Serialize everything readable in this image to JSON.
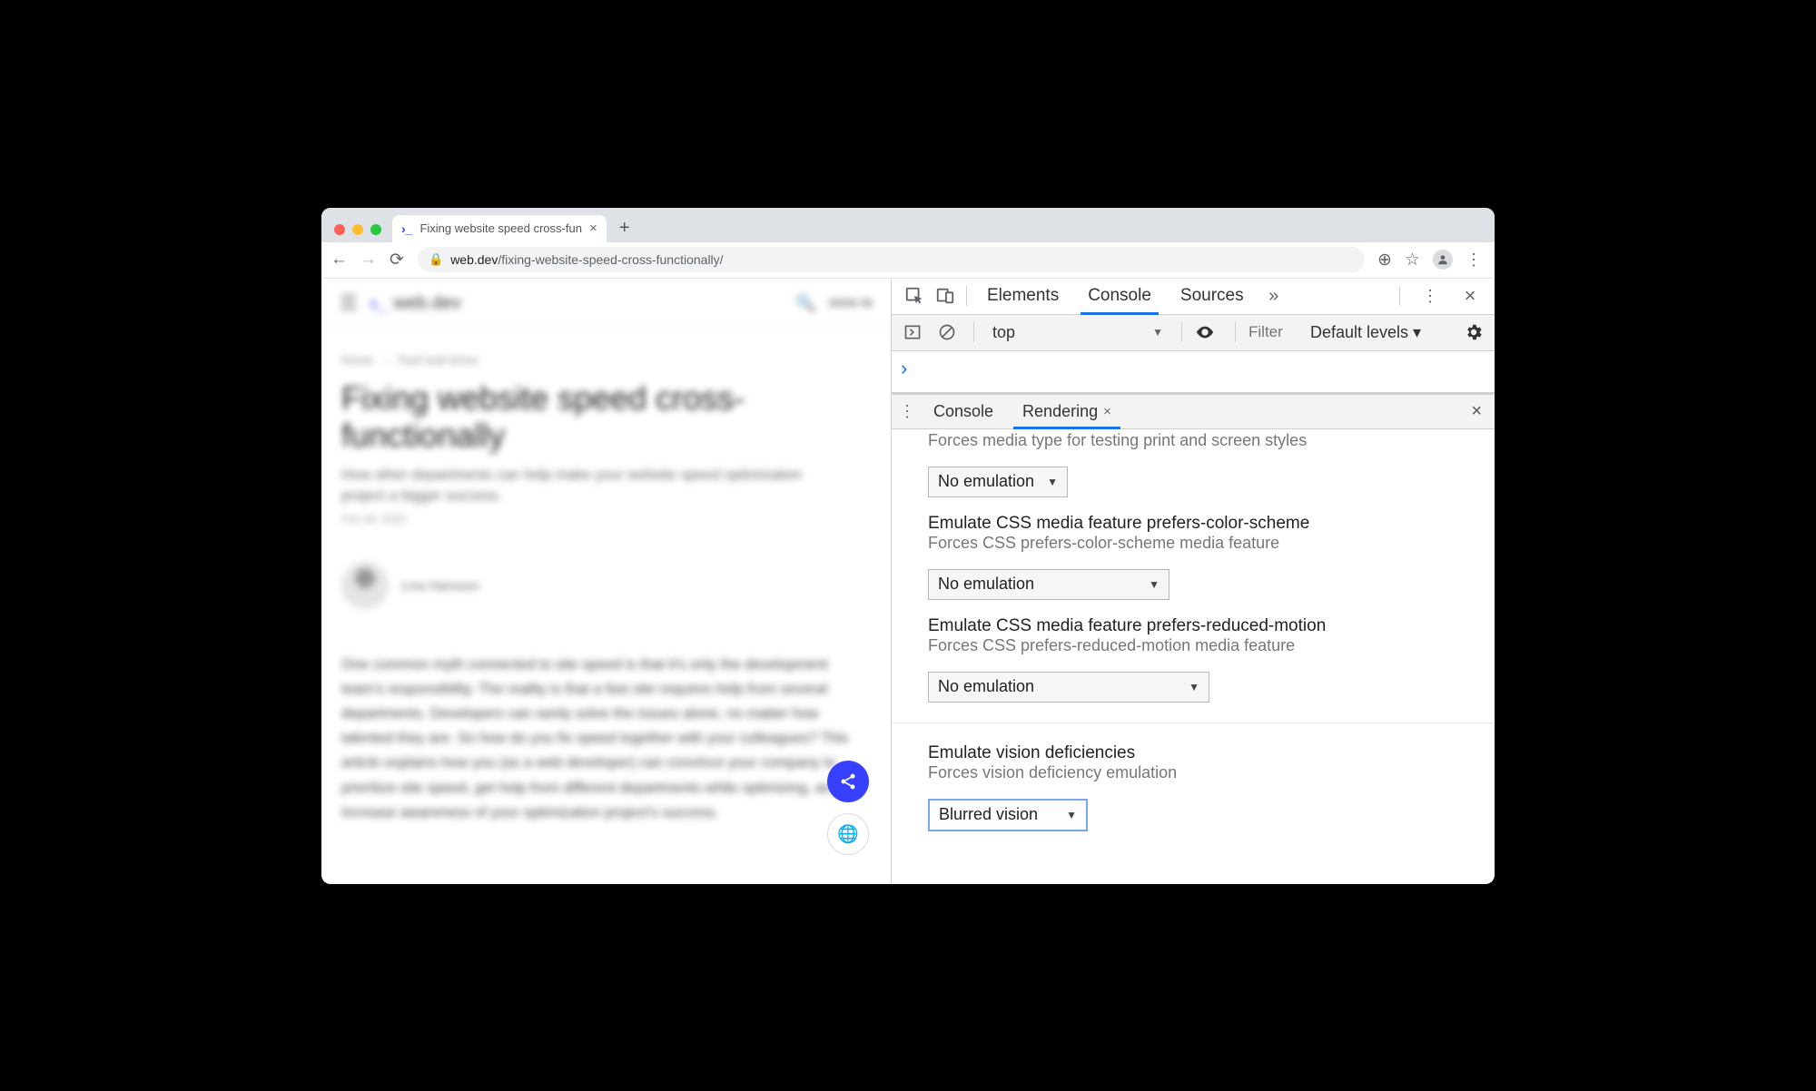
{
  "browser": {
    "tab_title": "Fixing website speed cross-fun",
    "url_host": "web.dev",
    "url_path": "/fixing-website-speed-cross-functionally/"
  },
  "page": {
    "site_name": "web.dev",
    "signin": "SIGN IN",
    "crumb_1": "Home",
    "crumb_2": "Fast load times",
    "title": "Fixing website speed cross-functionally",
    "subtitle": "How other departments can help make your website speed optimization project a bigger success.",
    "date": "Feb 28, 2020",
    "author": "Lina Hansson",
    "body": "One common myth connected to site speed is that it's only the development team's responsibility. The reality is that a fast site requires help from several departments. Developers can rarely solve the issues alone, no matter how talented they are. So how do you fix speed together with your colleagues? This article explains how you (as a web developer) can convince your company to prioritize site speed, get help from different departments while optimizing, and increase awareness of your optimization project's success."
  },
  "devtools": {
    "tabs": {
      "elements": "Elements",
      "console": "Console",
      "sources": "Sources"
    },
    "console_toolbar": {
      "context": "top",
      "filter_placeholder": "Filter",
      "levels": "Default levels ▾"
    },
    "console_prompt": "›",
    "drawer": {
      "tab_console": "Console",
      "tab_rendering": "Rendering"
    },
    "rendering": {
      "media_type_desc": "Forces media type for testing print and screen styles",
      "media_type_value": "No emulation",
      "pcs_title": "Emulate CSS media feature prefers-color-scheme",
      "pcs_desc": "Forces CSS prefers-color-scheme media feature",
      "pcs_value": "No emulation",
      "prm_title": "Emulate CSS media feature prefers-reduced-motion",
      "prm_desc": "Forces CSS prefers-reduced-motion media feature",
      "prm_value": "No emulation",
      "vis_title": "Emulate vision deficiencies",
      "vis_desc": "Forces vision deficiency emulation",
      "vis_value": "Blurred vision"
    }
  }
}
